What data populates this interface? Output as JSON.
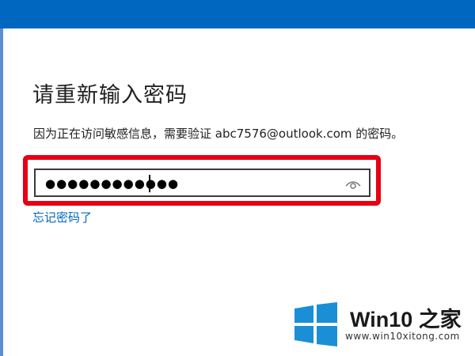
{
  "dialog": {
    "title": "请重新输入密码",
    "description": "因为正在访问敏感信息，需要验证 abc7576@outlook.com 的密码。",
    "password_value": "●●●●●●●●●●●●",
    "forgot_link": "忘记密码了"
  },
  "watermark": {
    "title": "Win10 之家",
    "url": "www.win10xitong.com"
  },
  "icons": {
    "reveal": "eye-icon",
    "logo": "windows-logo-icon"
  },
  "colors": {
    "accent": "#0067c0",
    "highlight": "#e60012",
    "text": "#222222"
  }
}
